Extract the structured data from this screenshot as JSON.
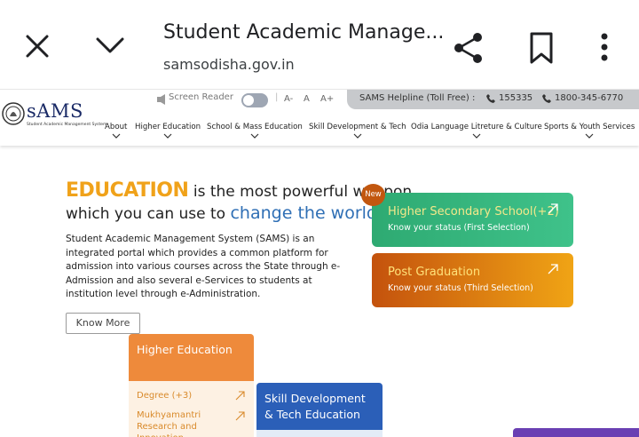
{
  "browser": {
    "title": "Student Academic Manage...",
    "url": "samsodisha.gov.in"
  },
  "header": {
    "logo_text": "sAMS",
    "logo_sub": "Student Academic Management System",
    "screen_reader_label": "Screen Reader",
    "font_sizes": [
      "A-",
      "A",
      "A+"
    ],
    "helpline_label": "SAMS Helpline (Toll Free) :",
    "helpline_numbers": [
      "155335",
      "1800-345-6770"
    ]
  },
  "nav": {
    "items": [
      {
        "label": "About"
      },
      {
        "label": "Higher Education"
      },
      {
        "label": "School & Mass Education"
      },
      {
        "label": "Skill Development & Tech"
      },
      {
        "label": "Odia Language Litreture & Culture"
      },
      {
        "label": "Sports & Youth Services"
      }
    ]
  },
  "hero": {
    "accent_word": "EDUCATION",
    "line1_rest": " is the most powerful weapon",
    "line2_start": "which you can use to ",
    "line2_highlight": "change the world",
    "description": "Student Academic Management System (SAMS) is an integrated portal which provides a common platform for admission into various courses across the State through e-Admission and also several e-Services to students at institution level through e-Administration.",
    "know_more_label": "Know More"
  },
  "cards": {
    "new_badge": "New",
    "hss": {
      "title": "Higher Secondary School(+2)",
      "subtitle": "Know your status (First Selection)"
    },
    "pg": {
      "title": "Post Graduation",
      "subtitle": "Know your status (Third Selection)"
    }
  },
  "tiles": {
    "higher_education": {
      "title": "Higher Education",
      "links": [
        "Degree (+3)",
        "Mukhyamantri Research and Innovation Fellowship"
      ]
    },
    "skill_development": {
      "title": "Skill Development & Tech Education"
    }
  },
  "colors": {
    "accent_orange": "#f0a21a",
    "accent_blue": "#2f6fb5",
    "card_green": "#3fc28a",
    "card_orange": "#f0a415",
    "tile_he": "#ee8a3b",
    "tile_sd": "#2b5fb8"
  }
}
